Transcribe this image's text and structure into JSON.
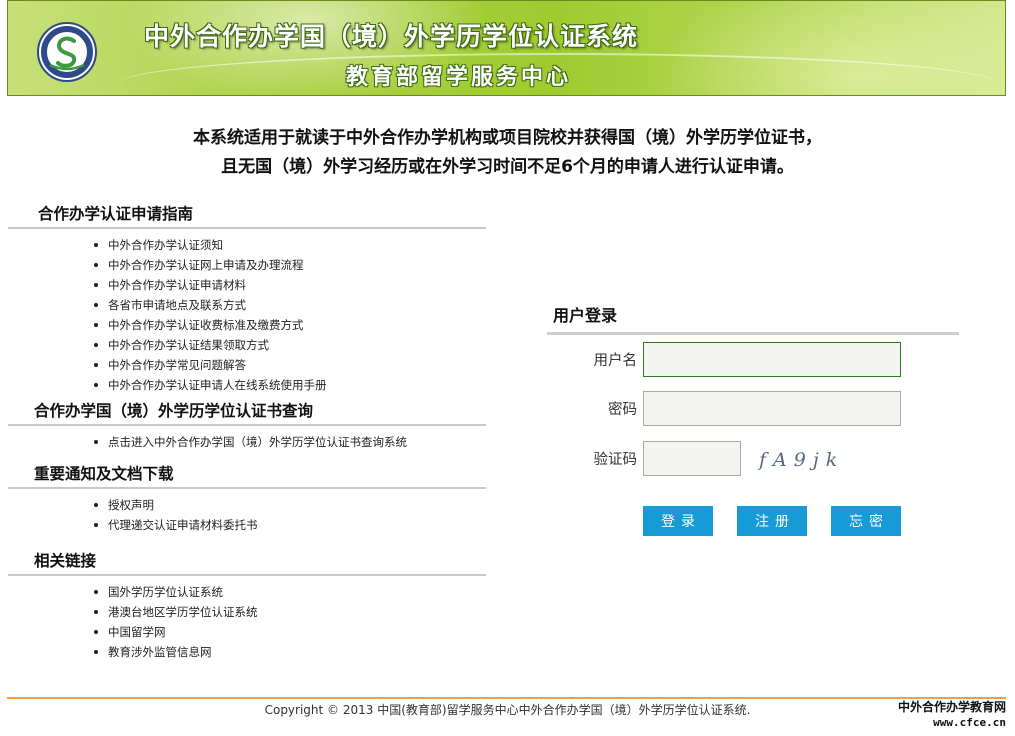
{
  "banner": {
    "title": "中外合作办学国（境）外学历学位认证系统",
    "subtitle": "教育部留学服务中心"
  },
  "intro": {
    "line1": "本系统适用于就读于中外合作办学机构或项目院校并获得国（境）外学历学位证书，",
    "line2": "且无国（境）外学习经历或在外学习时间不足6个月的申请人进行认证申请。"
  },
  "sections": {
    "guide": {
      "title": "合作办学认证申请指南",
      "items": [
        "中外合作办学认证须知",
        "中外合作办学认证网上申请及办理流程",
        "中外合作办学认证申请材料",
        "各省市申请地点及联系方式",
        "中外合作办学认证收费标准及缴费方式",
        "中外合作办学认证结果领取方式",
        "中外合作办学常见问题解答",
        "中外合作办学认证申请人在线系统使用手册"
      ]
    },
    "query": {
      "title": "合作办学国（境）外学历学位认证书查询",
      "items": [
        "点击进入中外合作办学国（境）外学历学位认证书查询系统"
      ]
    },
    "notices": {
      "title": "重要通知及文档下载",
      "items": [
        "授权声明",
        "代理递交认证申请材料委托书"
      ]
    },
    "links": {
      "title": "相关链接",
      "items": [
        "国外学历学位认证系统",
        "港澳台地区学历学位认证系统",
        "中国留学网",
        "教育涉外监管信息网"
      ]
    }
  },
  "login": {
    "title": "用户登录",
    "username_label": "用户名",
    "username_value": "",
    "password_label": "密码",
    "password_value": "",
    "captcha_label": "验证码",
    "captcha_value": "",
    "captcha_text": "fA9jk",
    "login_button": "登录",
    "register_button": "注册",
    "forgot_button": "忘密"
  },
  "footer": {
    "copyright": "Copyright © 2013 中国(教育部)留学服务中心中外合作办学国（境）外学历学位认证系统.",
    "watermark_name": "中外合作办学教育网",
    "watermark_url": "www.cfce.cn"
  },
  "colors": {
    "button": "#179bd7",
    "banner_green": "#9fcb2f",
    "footer_line": "#f0a040"
  }
}
